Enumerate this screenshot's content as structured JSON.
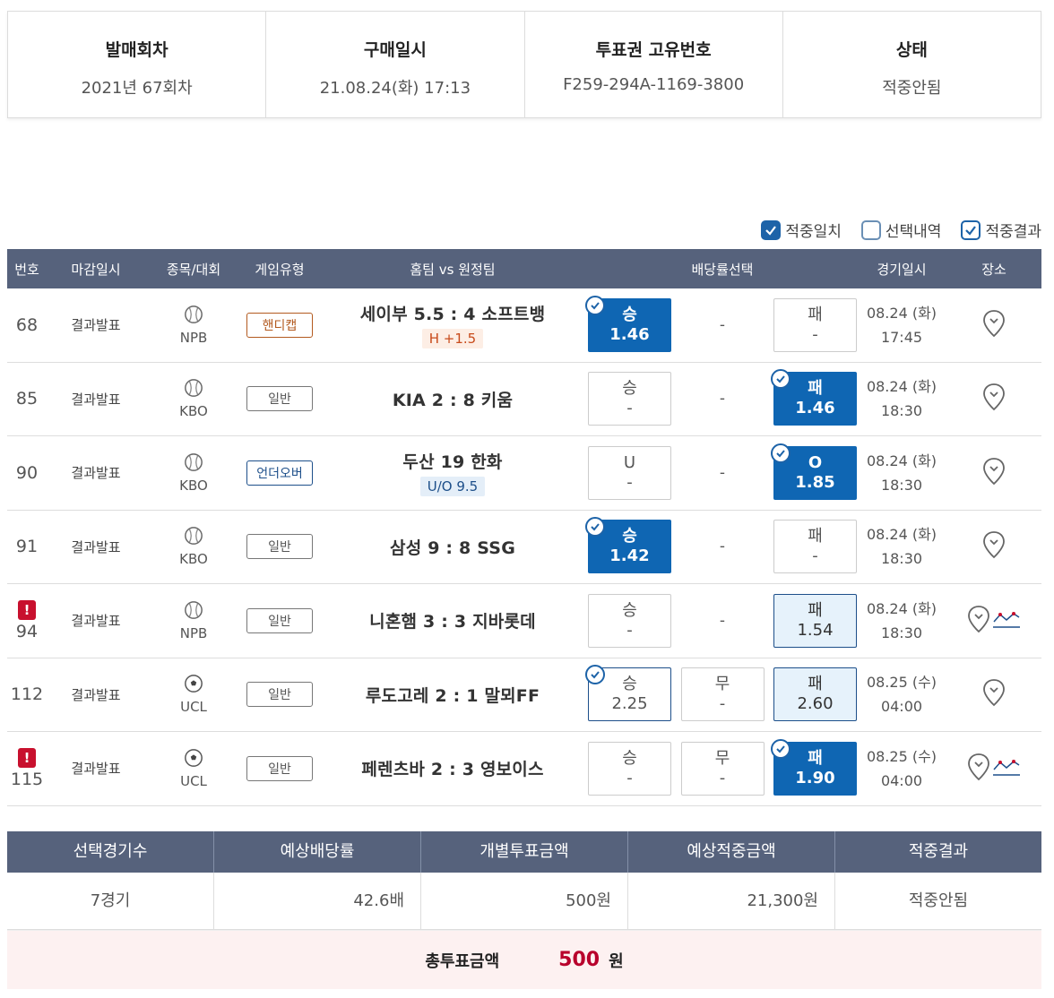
{
  "summary": {
    "round_label": "발매회차",
    "round_value": "2021년 67회차",
    "purchase_label": "구매일시",
    "purchase_value": "21.08.24(화) 17:13",
    "ticket_label": "투표권 고유번호",
    "ticket_value": "F259-294A-1169-3800",
    "status_label": "상태",
    "status_value": "적중안됨"
  },
  "legend": {
    "match": "적중일치",
    "selected": "선택내역",
    "result": "적중결과"
  },
  "table": {
    "headers": {
      "no": "번호",
      "deadline": "마감일시",
      "sport": "종목/대회",
      "gtype": "게임유형",
      "match": "홈팀 vs 원정팀",
      "odds": "배당률선택",
      "date": "경기일시",
      "place": "장소"
    },
    "rows": [
      {
        "no": "68",
        "deadline": "결과발표",
        "league": "NPB",
        "gtype": "핸디캡",
        "match": "세이부 5.5 : 4 소프트뱅",
        "tag": "H +1.5",
        "o1_label": "승",
        "o1_value": "1.46",
        "mid": "-",
        "o3_label": "패",
        "o3_value": "-",
        "date": "08.24 (화)",
        "time": "17:45"
      },
      {
        "no": "85",
        "deadline": "결과발표",
        "league": "KBO",
        "gtype": "일반",
        "match": "KIA 2 : 8 키움",
        "o1_label": "승",
        "o1_value": "-",
        "mid": "-",
        "o3_label": "패",
        "o3_value": "1.46",
        "date": "08.24 (화)",
        "time": "18:30"
      },
      {
        "no": "90",
        "deadline": "결과발표",
        "league": "KBO",
        "gtype": "언더오버",
        "match": "두산 19 한화",
        "tag": "U/O 9.5",
        "o1_label": "U",
        "o1_value": "-",
        "mid": "-",
        "o3_label": "O",
        "o3_value": "1.85",
        "date": "08.24 (화)",
        "time": "18:30"
      },
      {
        "no": "91",
        "deadline": "결과발표",
        "league": "KBO",
        "gtype": "일반",
        "match": "삼성 9 : 8 SSG",
        "o1_label": "승",
        "o1_value": "1.42",
        "mid": "-",
        "o3_label": "패",
        "o3_value": "-",
        "date": "08.24 (화)",
        "time": "18:30"
      },
      {
        "no": "94",
        "deadline": "결과발표",
        "league": "NPB",
        "gtype": "일반",
        "match": "니혼햄 3 : 3 지바롯데",
        "o1_label": "승",
        "o1_value": "-",
        "mid": "-",
        "o3_label": "패",
        "o3_value": "1.54",
        "date": "08.24 (화)",
        "time": "18:30"
      },
      {
        "no": "112",
        "deadline": "결과발표",
        "league": "UCL",
        "gtype": "일반",
        "match": "루도고레 2 : 1 말뫼FF",
        "o1_label": "승",
        "o1_value": "2.25",
        "o2_label": "무",
        "o2_value": "-",
        "o3_label": "패",
        "o3_value": "2.60",
        "date": "08.25 (수)",
        "time": "04:00"
      },
      {
        "no": "115",
        "deadline": "결과발표",
        "league": "UCL",
        "gtype": "일반",
        "match": "페렌츠바 2 : 3 영보이스",
        "o1_label": "승",
        "o1_value": "-",
        "o2_label": "무",
        "o2_value": "-",
        "o3_label": "패",
        "o3_value": "1.90",
        "date": "08.25 (수)",
        "time": "04:00"
      }
    ]
  },
  "bottom": {
    "h1": "선택경기수",
    "h2": "예상배당률",
    "h3": "개별투표금액",
    "h4": "예상적중금액",
    "h5": "적중결과",
    "v1": "7경기",
    "v2": "42.6배",
    "v3": "500원",
    "v4": "21,300원",
    "v5": "적중안됨",
    "total_label": "총투표금액",
    "total_amount": "500",
    "total_unit": "원"
  },
  "colors": {
    "header_bg": "#56627c",
    "selected": "#0f66b3",
    "highlight": "#e6f2fb",
    "warning": "#c8102e",
    "total_bg": "#fdf1f1"
  },
  "icons": {
    "baseball": "baseball-icon",
    "soccer": "soccer-icon",
    "pin": "map-pin-icon",
    "trend": "trend-chart-icon",
    "warn": "exclamation-icon"
  }
}
